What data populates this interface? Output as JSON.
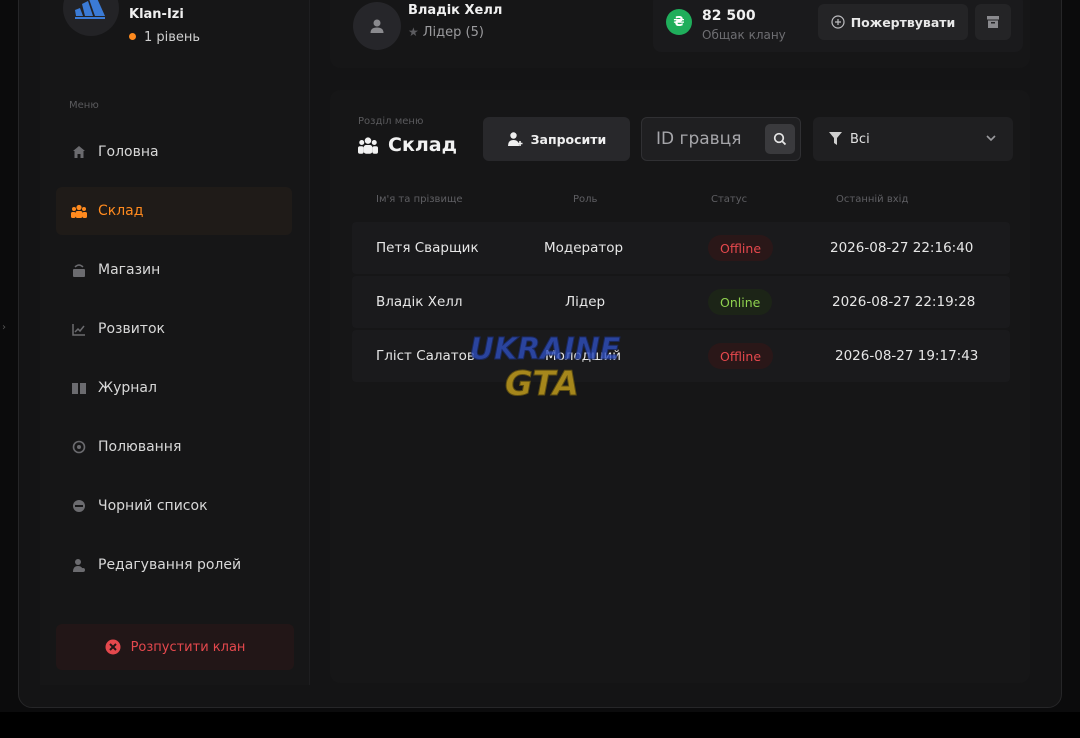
{
  "clan": {
    "name": "Klan-Izi",
    "level": "1 рівень"
  },
  "sidebar": {
    "caption": "Меню",
    "items": [
      {
        "label": "Головна",
        "icon": "home-icon"
      },
      {
        "label": "Склад",
        "icon": "users-icon",
        "active": true
      },
      {
        "label": "Магазин",
        "icon": "shop-icon"
      },
      {
        "label": "Розвиток",
        "icon": "chart-icon"
      },
      {
        "label": "Журнал",
        "icon": "book-icon"
      },
      {
        "label": "Полювання",
        "icon": "target-icon"
      },
      {
        "label": "Чорний список",
        "icon": "block-icon"
      },
      {
        "label": "Редагування ролей",
        "icon": "role-icon"
      }
    ],
    "disband_label": "Розпустити клан"
  },
  "header": {
    "user_name": "Владік Хелл",
    "user_role": "Лідер (5)",
    "balance_amount": "82 500",
    "balance_label": "Общак клану",
    "coin_symbol": "₴",
    "donate_label": "Пожертвувати"
  },
  "main": {
    "caption": "Розділ меню",
    "title": "Склад",
    "invite_label": "Запросити",
    "search_placeholder": "ID гравця",
    "filter_value": "Всі",
    "columns": [
      "Ім'я та прізвище",
      "Роль",
      "Статус",
      "Останній вхід"
    ],
    "rows": [
      {
        "name": "Петя Сварщик",
        "role": "Модератор",
        "status": "Offline",
        "last_login": "2026-08-27 22:16:40"
      },
      {
        "name": "Владік Хелл",
        "role": "Лідер",
        "status": "Online",
        "last_login": "2026-08-27 22:19:28"
      },
      {
        "name": "Гліст Салатов",
        "role": "Молодший",
        "status": "Offline",
        "last_login": "2026-08-27 19:17:43"
      }
    ]
  },
  "watermark": {
    "line1": "UKRAINE",
    "line2": "GTA"
  },
  "colors": {
    "accent": "#ff8a1e",
    "offline": "#e5484d",
    "online": "#8fd14f",
    "coin": "#1fae5b"
  }
}
